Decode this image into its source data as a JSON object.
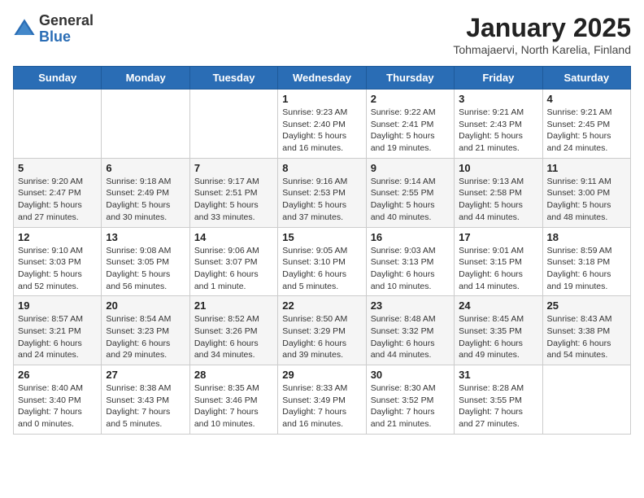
{
  "logo": {
    "general": "General",
    "blue": "Blue"
  },
  "header": {
    "month": "January 2025",
    "location": "Tohmajaervi, North Karelia, Finland"
  },
  "weekdays": [
    "Sunday",
    "Monday",
    "Tuesday",
    "Wednesday",
    "Thursday",
    "Friday",
    "Saturday"
  ],
  "weeks": [
    [
      {
        "day": "",
        "info": ""
      },
      {
        "day": "",
        "info": ""
      },
      {
        "day": "",
        "info": ""
      },
      {
        "day": "1",
        "info": "Sunrise: 9:23 AM\nSunset: 2:40 PM\nDaylight: 5 hours and 16 minutes."
      },
      {
        "day": "2",
        "info": "Sunrise: 9:22 AM\nSunset: 2:41 PM\nDaylight: 5 hours and 19 minutes."
      },
      {
        "day": "3",
        "info": "Sunrise: 9:21 AM\nSunset: 2:43 PM\nDaylight: 5 hours and 21 minutes."
      },
      {
        "day": "4",
        "info": "Sunrise: 9:21 AM\nSunset: 2:45 PM\nDaylight: 5 hours and 24 minutes."
      }
    ],
    [
      {
        "day": "5",
        "info": "Sunrise: 9:20 AM\nSunset: 2:47 PM\nDaylight: 5 hours and 27 minutes."
      },
      {
        "day": "6",
        "info": "Sunrise: 9:18 AM\nSunset: 2:49 PM\nDaylight: 5 hours and 30 minutes."
      },
      {
        "day": "7",
        "info": "Sunrise: 9:17 AM\nSunset: 2:51 PM\nDaylight: 5 hours and 33 minutes."
      },
      {
        "day": "8",
        "info": "Sunrise: 9:16 AM\nSunset: 2:53 PM\nDaylight: 5 hours and 37 minutes."
      },
      {
        "day": "9",
        "info": "Sunrise: 9:14 AM\nSunset: 2:55 PM\nDaylight: 5 hours and 40 minutes."
      },
      {
        "day": "10",
        "info": "Sunrise: 9:13 AM\nSunset: 2:58 PM\nDaylight: 5 hours and 44 minutes."
      },
      {
        "day": "11",
        "info": "Sunrise: 9:11 AM\nSunset: 3:00 PM\nDaylight: 5 hours and 48 minutes."
      }
    ],
    [
      {
        "day": "12",
        "info": "Sunrise: 9:10 AM\nSunset: 3:03 PM\nDaylight: 5 hours and 52 minutes."
      },
      {
        "day": "13",
        "info": "Sunrise: 9:08 AM\nSunset: 3:05 PM\nDaylight: 5 hours and 56 minutes."
      },
      {
        "day": "14",
        "info": "Sunrise: 9:06 AM\nSunset: 3:07 PM\nDaylight: 6 hours and 1 minute."
      },
      {
        "day": "15",
        "info": "Sunrise: 9:05 AM\nSunset: 3:10 PM\nDaylight: 6 hours and 5 minutes."
      },
      {
        "day": "16",
        "info": "Sunrise: 9:03 AM\nSunset: 3:13 PM\nDaylight: 6 hours and 10 minutes."
      },
      {
        "day": "17",
        "info": "Sunrise: 9:01 AM\nSunset: 3:15 PM\nDaylight: 6 hours and 14 minutes."
      },
      {
        "day": "18",
        "info": "Sunrise: 8:59 AM\nSunset: 3:18 PM\nDaylight: 6 hours and 19 minutes."
      }
    ],
    [
      {
        "day": "19",
        "info": "Sunrise: 8:57 AM\nSunset: 3:21 PM\nDaylight: 6 hours and 24 minutes."
      },
      {
        "day": "20",
        "info": "Sunrise: 8:54 AM\nSunset: 3:23 PM\nDaylight: 6 hours and 29 minutes."
      },
      {
        "day": "21",
        "info": "Sunrise: 8:52 AM\nSunset: 3:26 PM\nDaylight: 6 hours and 34 minutes."
      },
      {
        "day": "22",
        "info": "Sunrise: 8:50 AM\nSunset: 3:29 PM\nDaylight: 6 hours and 39 minutes."
      },
      {
        "day": "23",
        "info": "Sunrise: 8:48 AM\nSunset: 3:32 PM\nDaylight: 6 hours and 44 minutes."
      },
      {
        "day": "24",
        "info": "Sunrise: 8:45 AM\nSunset: 3:35 PM\nDaylight: 6 hours and 49 minutes."
      },
      {
        "day": "25",
        "info": "Sunrise: 8:43 AM\nSunset: 3:38 PM\nDaylight: 6 hours and 54 minutes."
      }
    ],
    [
      {
        "day": "26",
        "info": "Sunrise: 8:40 AM\nSunset: 3:40 PM\nDaylight: 7 hours and 0 minutes."
      },
      {
        "day": "27",
        "info": "Sunrise: 8:38 AM\nSunset: 3:43 PM\nDaylight: 7 hours and 5 minutes."
      },
      {
        "day": "28",
        "info": "Sunrise: 8:35 AM\nSunset: 3:46 PM\nDaylight: 7 hours and 10 minutes."
      },
      {
        "day": "29",
        "info": "Sunrise: 8:33 AM\nSunset: 3:49 PM\nDaylight: 7 hours and 16 minutes."
      },
      {
        "day": "30",
        "info": "Sunrise: 8:30 AM\nSunset: 3:52 PM\nDaylight: 7 hours and 21 minutes."
      },
      {
        "day": "31",
        "info": "Sunrise: 8:28 AM\nSunset: 3:55 PM\nDaylight: 7 hours and 27 minutes."
      },
      {
        "day": "",
        "info": ""
      }
    ]
  ]
}
